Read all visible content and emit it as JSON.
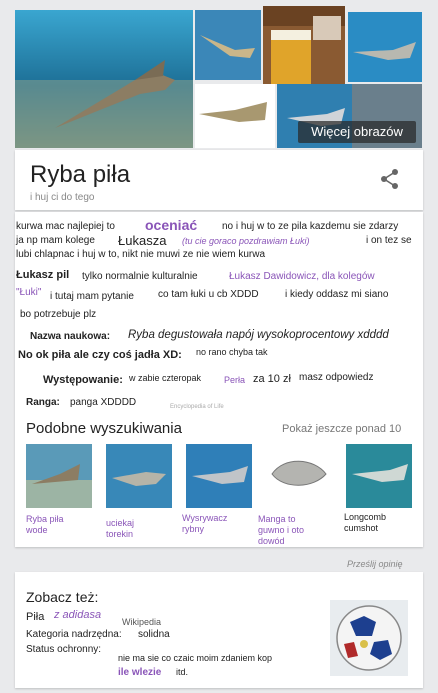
{
  "images": {
    "more_images_label": "Więcej obrazów"
  },
  "header": {
    "title": "Ryba piła",
    "subtitle": "i huj ci do tego"
  },
  "description": {
    "line1_a": "kurwa mac najlepiej to",
    "line1_b": "oceniać",
    "line1_c": "no i huj w to ze pila kazdemu sie zdarzy",
    "line2_a": "ja np mam kolege",
    "line2_b": "Łukasza",
    "line2_c": "(tu cie goraco pozdrawiam Łuki)",
    "line2_d": "i on tez se",
    "line3": "lubi chlapnac i huj w to, nikt nie muwi ze nie wiem kurwa",
    "line4_a": "Łukasz pil",
    "line4_b": "tylko normalnie kulturalnie",
    "line4_c": "Łukasz Dawidowicz, dla kolegów",
    "line5_a": "\"Łuki\"",
    "line5_b": "i tutaj mam pytanie",
    "line5_c": "co tam łuki u cb XDDD",
    "line5_d": "i kiedy oddasz mi siano",
    "line6": "bo potrzebuje plz"
  },
  "facts": {
    "sci_label": "Nazwa naukowa:",
    "sci_value": "Ryba degustowała napój wysokoprocentowy xdddd",
    "q_label": "No ok piła ale czy coś jadła XD:",
    "q_value": "no rano chyba tak",
    "occ_label": "Występowanie:",
    "occ_value_a": "w zabie czteropak",
    "occ_value_b": "Perła",
    "occ_value_c": "za 10 zł",
    "occ_value_d": "masz odpowiedz",
    "rank_label": "Ranga:",
    "rank_value": "panga XDDDD",
    "source": "Encyclopedia of Life"
  },
  "similar": {
    "heading": "Podobne wyszukiwania",
    "more": "Pokaż jeszcze ponad 10",
    "items": [
      {
        "label": "Ryba piła wode"
      },
      {
        "label": "uciekaj torekin"
      },
      {
        "label": "Wysrywacz rybny"
      },
      {
        "label": "Manga to guwno i oto dowód"
      },
      {
        "label": "Longcomb cumshot"
      }
    ]
  },
  "feedback": "Prześlij opinię",
  "see_also": {
    "heading": "Zobacz też:",
    "pila_label": "Piła",
    "pila_value": "z adidasa",
    "wikipedia": "Wikipedia",
    "category_label": "Kategoria nadrzędna:",
    "category_value": "solidna",
    "status_label": "Status ochronny:",
    "status_value": "nie ma sie co czaic moim zdaniem kop",
    "status_value2": "ile wlezie",
    "status_value3": "itd."
  },
  "colors": {
    "accent_purple": "#8a55b8",
    "ocean_blue": "#2a78b8",
    "card_bg": "#ffffff",
    "page_bg": "#e9eaec"
  }
}
